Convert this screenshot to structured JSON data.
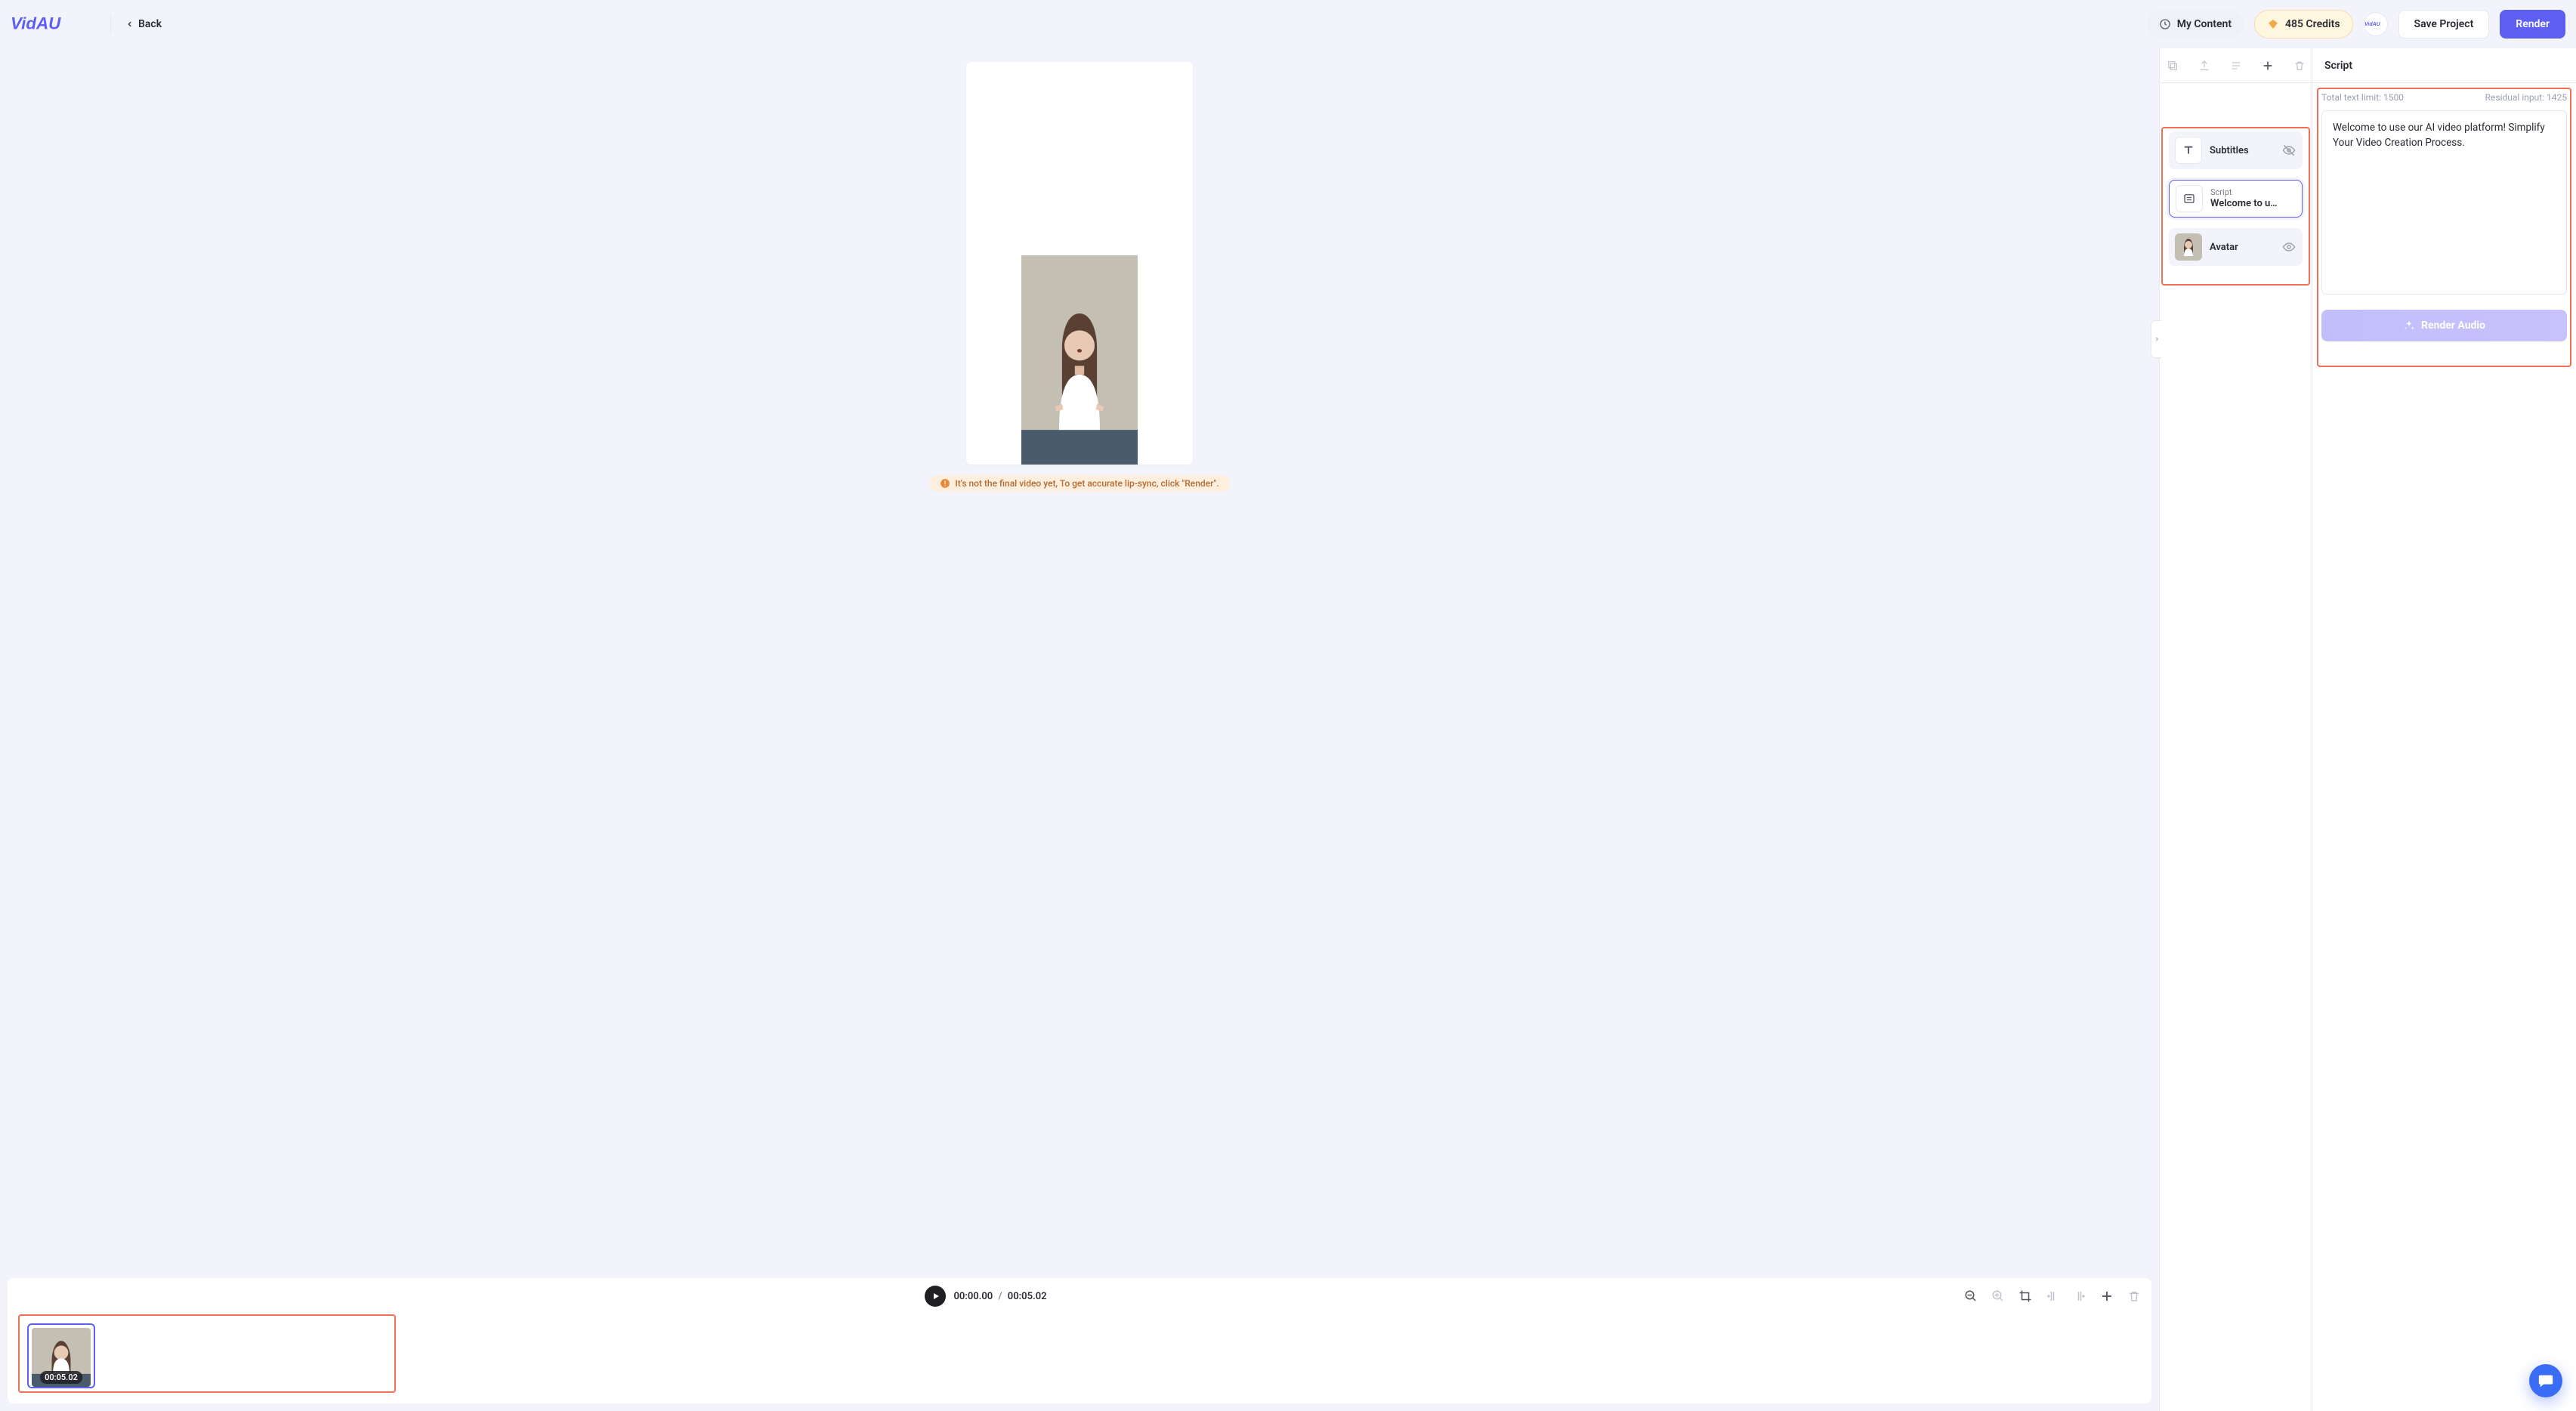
{
  "brand": "VidAU",
  "topbar": {
    "back_label": "Back",
    "my_content_label": "My Content",
    "credits_text": "485 Credits",
    "save_label": "Save Project",
    "render_label": "Render"
  },
  "canvas": {
    "warning_text": "It's not the final video yet, To get accurate lip-sync, click \"Render\"."
  },
  "playback": {
    "current": "00:00.00",
    "total": "00:05.02"
  },
  "clip": {
    "duration_label": "00:05.02"
  },
  "layers": {
    "subtitles": {
      "label": "Subtitles",
      "visible_icon": "eye-off"
    },
    "script": {
      "small": "Script",
      "main": "Welcome to u…"
    },
    "avatar": {
      "label": "Avatar",
      "visible_icon": "eye"
    }
  },
  "script": {
    "header": "Script",
    "limit_label": "Total text limit: 1500",
    "residual_label": "Residual input: 1425",
    "content": "Welcome to use our AI video platform! Simplify Your Video Creation Process.",
    "render_audio_label": "Render Audio"
  }
}
